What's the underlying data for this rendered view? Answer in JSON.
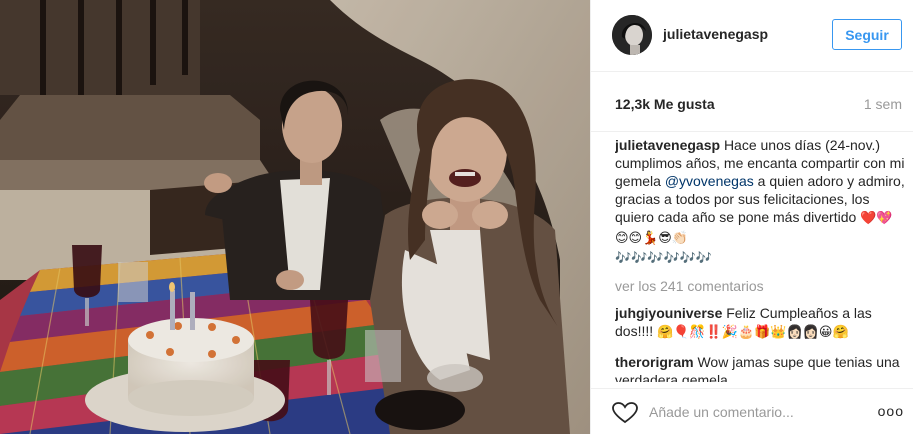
{
  "post": {
    "username": "julietavenegasp",
    "follow_label": "Seguir",
    "likes": "12,3k Me gusta",
    "time": "1 sem",
    "caption": {
      "username": "julietavenegasp",
      "text_before": "Hace unos días (24-nov.) cumplimos años, me encanta compartir con mi gemela",
      "mention": "@yvovenegas",
      "text_after": "a quien adoro y admiro, gracias a todos por sus felicitaciones, los quiero cada año se pone más divertido",
      "emojis": "❤️💖😊😊💃😎👏🏻",
      "notes": "🎶🎶🎶🎶🎶🎶"
    },
    "view_all": "ver los 241 comentarios",
    "comments": [
      {
        "username": "juhgiyouniverse",
        "text": "Feliz Cumpleaños a las dos!!!!",
        "emojis": "🤗🎈🎊‼️🎉🎂🎁👑👩🏻👩🏻😀🤗"
      },
      {
        "username": "therorigram",
        "text": "Wow jamas supe que tenias una verdadera gemela",
        "emojis": ""
      }
    ],
    "comment_placeholder": "Añade un comentario...",
    "more_label": "ooo"
  },
  "icons": {
    "like": "heart-outline-icon",
    "options": "more-options-icon"
  },
  "colors": {
    "accent": "#3897f0",
    "mention": "#003569",
    "muted": "#999999",
    "text": "#262626",
    "border": "#efefef"
  }
}
